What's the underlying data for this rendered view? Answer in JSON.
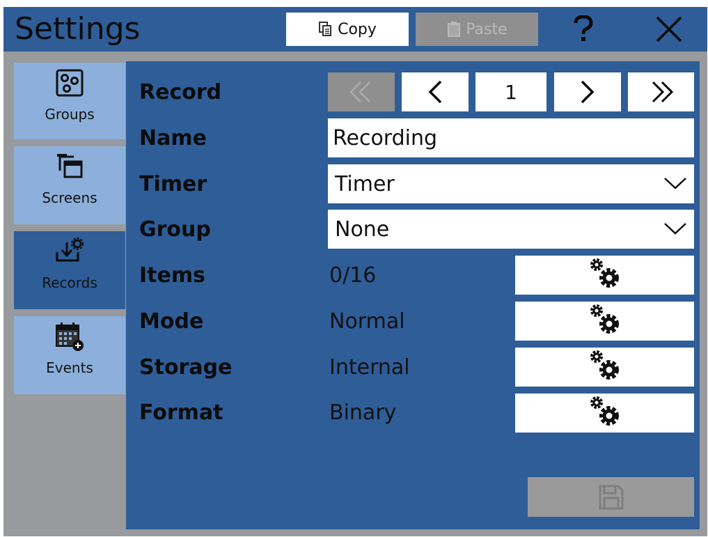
{
  "window": {
    "title": "Settings"
  },
  "toolbar": {
    "copy_label": "Copy",
    "paste_label": "Paste",
    "help_icon": "question-mark-icon",
    "close_icon": "close-icon"
  },
  "sidebar": {
    "items": [
      {
        "label": "Groups",
        "icon": "groups-icon",
        "active": false
      },
      {
        "label": "Screens",
        "icon": "screens-icon",
        "active": false
      },
      {
        "label": "Records",
        "icon": "records-icon",
        "active": true
      },
      {
        "label": "Events",
        "icon": "events-calendar-icon",
        "active": false
      }
    ]
  },
  "form": {
    "record": {
      "label": "Record",
      "value": "1"
    },
    "name": {
      "label": "Name",
      "value": "Recording"
    },
    "timer": {
      "label": "Timer",
      "value": "Timer"
    },
    "group": {
      "label": "Group",
      "value": "None"
    },
    "items": {
      "label": "Items",
      "value": "0/16"
    },
    "mode": {
      "label": "Mode",
      "value": "Normal"
    },
    "storage": {
      "label": "Storage",
      "value": "Internal"
    },
    "format": {
      "label": "Format",
      "value": "Binary"
    }
  },
  "colors": {
    "accent": "#2f5d98",
    "sidebar_inactive": "#8cb0db",
    "background": "#999a9d",
    "disabled": "#8f8f8f"
  }
}
